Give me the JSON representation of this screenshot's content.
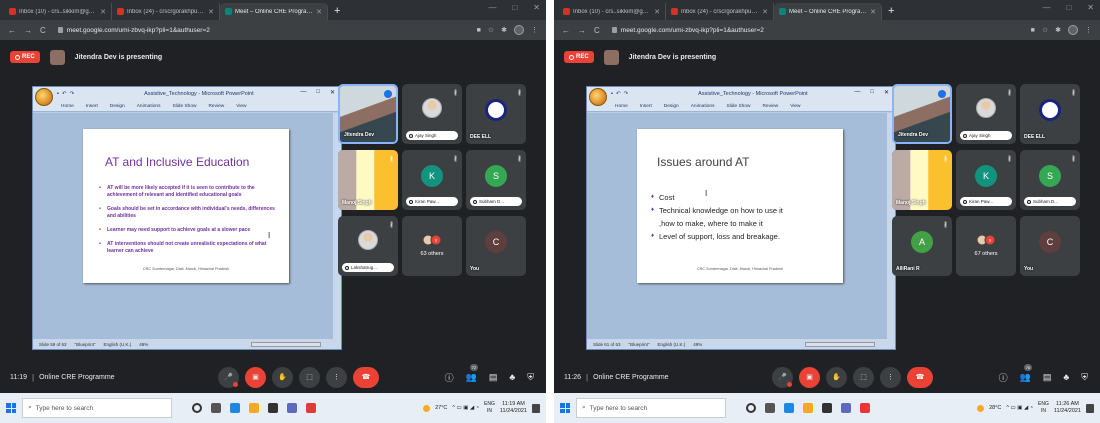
{
  "screens": [
    {
      "tabs": [
        {
          "label": "Inbox (10) - crs..sikkim@gmail.c",
          "close": "✕"
        },
        {
          "label": "Inbox (24) - crscrgorakhpur202",
          "close": "✕"
        },
        {
          "label": "Meet – Online CRE Programm",
          "close": "✕"
        }
      ],
      "new_tab": "+",
      "url": "meet.google.com/umi-zbvq-ikp?pli=1&authuser=2",
      "rec_label": "REC",
      "presenting_text": "Jitendra Dev is presenting",
      "ppt": {
        "doc_title": "Assistive_Technology - Microsoft PowerPoint",
        "ribbon": [
          "Home",
          "Insert",
          "Design",
          "Animations",
          "Slide Show",
          "Review",
          "View"
        ],
        "status": [
          "Slide 59 of 63",
          "\"Blueprint\"",
          "English (U.K.)"
        ],
        "zoom": "49%"
      },
      "slide": {
        "title": "AT and Inclusive Education",
        "bullets": [
          "AT will be more likely accepted if it is seen to contribute to the achievement of relevant and identified educational goals",
          "Goals should be set in accordance with individual's needs, differences and abilities",
          "Learner may need support to achieve goals at a slower pace",
          "AT interventions should not create unrealistic expectations of what learner can achieve"
        ],
        "footer": "CRC Sundernagar, Distt. Mandi, Himachal Pradesh"
      },
      "tiles": [
        {
          "name": "Jitendra Dev",
          "style": "label",
          "kind": "video",
          "active": true
        },
        {
          "name": "Ajay Singh",
          "style": "pill",
          "kind": "photo"
        },
        {
          "name": "DEE ELL",
          "style": "label",
          "kind": "logo"
        },
        {
          "name": "Manoj Singh",
          "style": "label",
          "kind": "video"
        },
        {
          "name": "Kiran Paw...",
          "style": "pill",
          "kind": "avatar",
          "initial": "K",
          "color": "#12937f"
        },
        {
          "name": "Subham D...",
          "style": "pill",
          "kind": "avatar",
          "initial": "S",
          "color": "#34a853"
        },
        {
          "name": "Lakshatrug...",
          "style": "pill",
          "kind": "photo"
        },
        {
          "name": "63 others",
          "style": "others",
          "kind": "others",
          "badge": "S"
        },
        {
          "name": "You",
          "style": "label",
          "kind": "avatar",
          "initial": "C",
          "color": "#5f3e3e"
        }
      ],
      "bottom": {
        "time": "11:19",
        "separator": "|",
        "meeting": "Online CRE Programme",
        "people_count": "72"
      },
      "taskbar": {
        "search": "Type here to search",
        "temp": "27°C",
        "lang": "ENG",
        "region": "IN",
        "time": "11:19 AM",
        "date": "11/24/2021"
      }
    },
    {
      "tabs": [
        {
          "label": "Inbox (10) - crs..sikkim@gmail.c",
          "close": "✕"
        },
        {
          "label": "Inbox (24) - crscrgorakhpur202",
          "close": "✕"
        },
        {
          "label": "Meet – Online CRE Programm",
          "close": "✕"
        }
      ],
      "new_tab": "+",
      "url": "meet.google.com/umi-zbvq-ikp?pli=1&authuser=2",
      "rec_label": "REC",
      "presenting_text": "Jitendra Dev is presenting",
      "ppt": {
        "doc_title": "Assistive_Technology - Microsoft PowerPoint",
        "ribbon": [
          "Home",
          "Insert",
          "Design",
          "Animations",
          "Slide Show",
          "Review",
          "View"
        ],
        "status": [
          "Slide 61 of 63",
          "\"Blueprint\"",
          "English (U.K.)"
        ],
        "zoom": "49%"
      },
      "slide": {
        "title": "Issues around AT",
        "bullets": [
          "Cost",
          "Technical knowledge on how to use it",
          ",how to make, where to make it",
          "Level of support, loss and breakage."
        ],
        "footer": "CRC Sundernagar, Distt. Mandi, Himachal Pradesh"
      },
      "tiles": [
        {
          "name": "Jitendra Dev",
          "style": "label",
          "kind": "video",
          "active": true
        },
        {
          "name": "Ajay Singh",
          "style": "pill",
          "kind": "photo"
        },
        {
          "name": "DEE ELL",
          "style": "label",
          "kind": "logo"
        },
        {
          "name": "Manoj Singh",
          "style": "label",
          "kind": "video"
        },
        {
          "name": "Kiran Paw...",
          "style": "pill",
          "kind": "avatar",
          "initial": "K",
          "color": "#12937f"
        },
        {
          "name": "Subham D...",
          "style": "pill",
          "kind": "avatar",
          "initial": "S",
          "color": "#34a853"
        },
        {
          "name": "AlliRani R",
          "style": "label",
          "kind": "avatar",
          "initial": "A",
          "color": "#43a047"
        },
        {
          "name": "67 others",
          "style": "others",
          "kind": "others",
          "badge": "S"
        },
        {
          "name": "You",
          "style": "label",
          "kind": "avatar",
          "initial": "C",
          "color": "#5f3e3e"
        }
      ],
      "bottom": {
        "time": "11:26",
        "separator": "|",
        "meeting": "Online CRE Programme",
        "people_count": "76"
      },
      "taskbar": {
        "search": "Type here to search",
        "temp": "28°C",
        "lang": "ENG",
        "region": "IN",
        "time": "11:26 AM",
        "date": "11/24/2021"
      }
    }
  ],
  "icons": {
    "back": "←",
    "forward": "→",
    "reload": "C",
    "star": "☆",
    "minimize": "—",
    "maximize": "□",
    "close": "✕",
    "mic": "🎤",
    "cam": "▣",
    "hand": "✋",
    "present": "⬚",
    "more": "⋮",
    "end": "☎",
    "info": "ⓘ",
    "people": "👥",
    "chat": "▤",
    "activities": "♣",
    "lock": "🔒"
  }
}
